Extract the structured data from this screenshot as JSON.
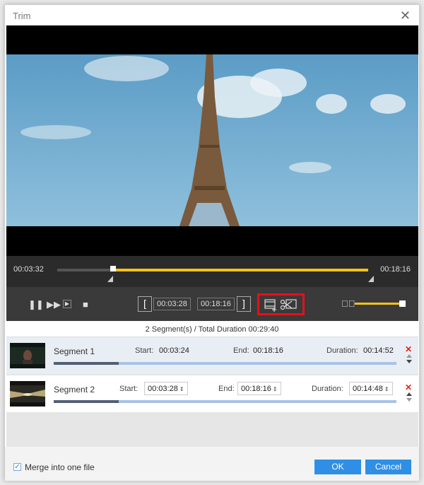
{
  "window": {
    "title": "Trim",
    "close_icon": "close-icon"
  },
  "timeline": {
    "current_time": "00:03:32",
    "end_time": "00:18:16",
    "selection_start_fraction": 0.18,
    "selection_end_fraction": 1.0
  },
  "controls": {
    "pause_icon": "pause-icon",
    "forward_icon": "fast-forward-icon",
    "next_frame_icon": "next-frame-icon",
    "stop_icon": "stop-icon",
    "set_start_icon": "bracket-left-icon",
    "start_time": "00:03:28",
    "end_time": "00:18:16",
    "set_end_icon": "bracket-right-icon",
    "add_segment_icon": "add-segment-icon",
    "split_icon": "scissors-icon",
    "volume_icon": "volume-icon",
    "volume_level": 1.0,
    "accent_color": "#f2c21a"
  },
  "summary": "2 Segment(s) / Total Duration 00:29:40",
  "segments": [
    {
      "name": "Segment 1",
      "start_label": "Start:",
      "start": "00:03:24",
      "end_label": "End:",
      "end": "00:18:16",
      "duration_label": "Duration:",
      "duration": "00:14:52",
      "progress_fraction": 0.19
    },
    {
      "name": "Segment 2",
      "start_label": "Start:",
      "start": "00:03:28",
      "end_label": "End:",
      "end": "00:18:16",
      "duration_label": "Duration:",
      "duration": "00:14:48",
      "progress_fraction": 0.19
    }
  ],
  "footer": {
    "merge_label": "Merge into one file",
    "merge_checked": true,
    "ok_label": "OK",
    "cancel_label": "Cancel"
  }
}
